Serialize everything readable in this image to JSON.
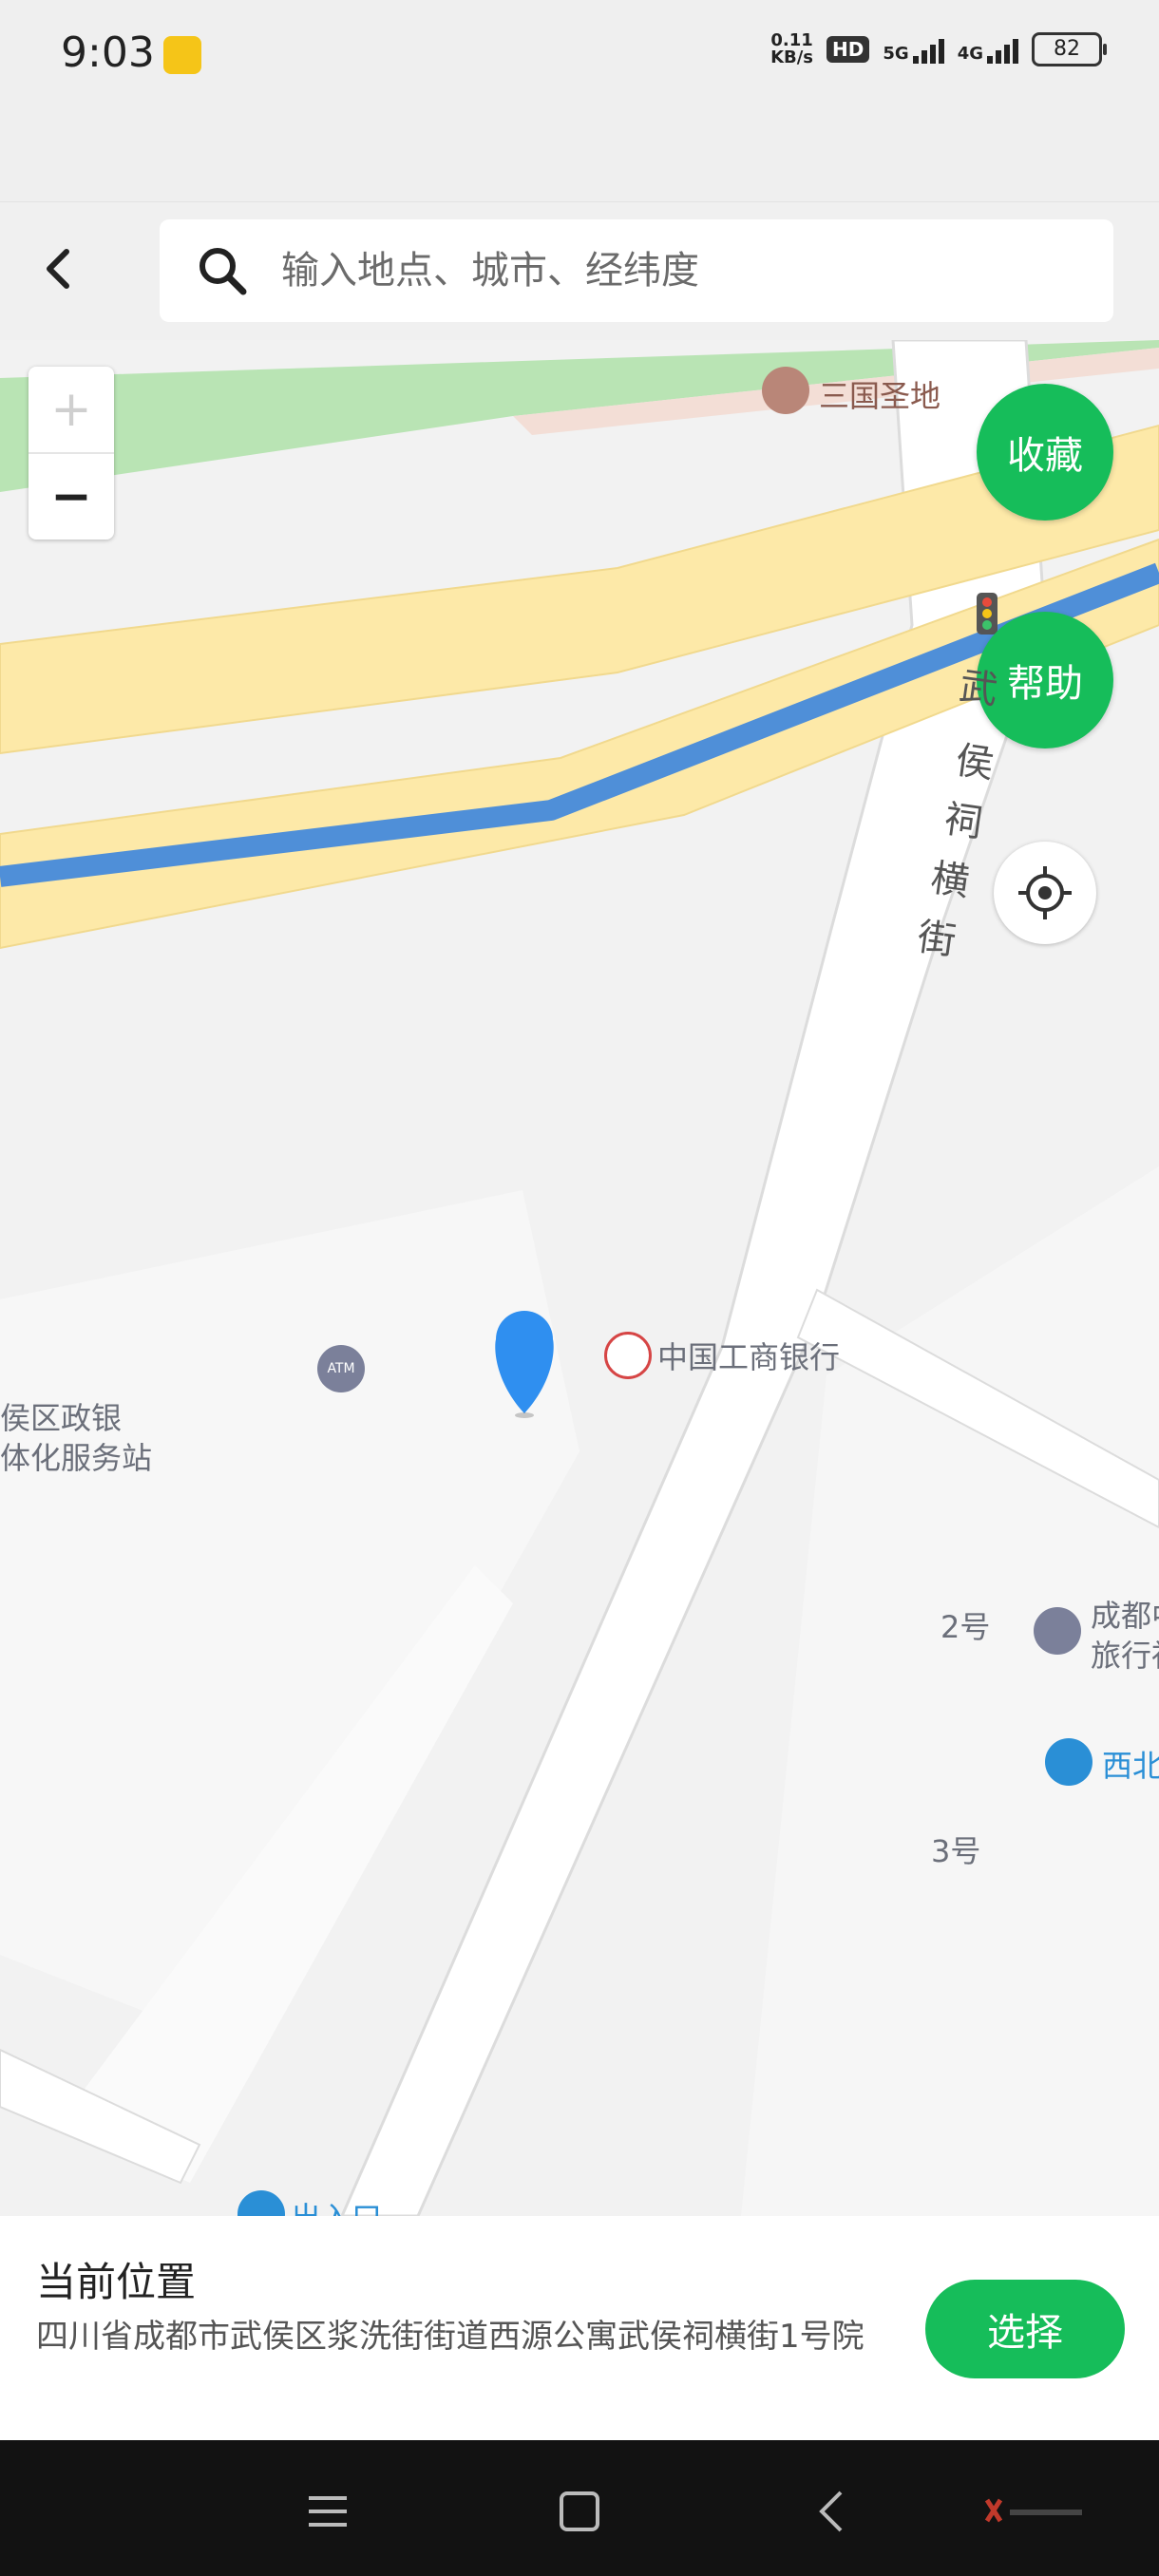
{
  "status_bar": {
    "time": "9:03",
    "net_speed_value": "0.11",
    "net_speed_unit": "KB/s",
    "hd": "HD",
    "sim1": "5G",
    "sim2": "4G",
    "battery": "82"
  },
  "header": {
    "search_placeholder": "输入地点、城市、经纬度"
  },
  "map": {
    "zoom_in": "+",
    "zoom_out": "−",
    "buttons": {
      "favorite": "收藏",
      "help": "帮助"
    },
    "street_name": [
      "武",
      "侯",
      "祠",
      "横",
      "街"
    ],
    "pois": {
      "sanguo": "三国圣地",
      "atm": "ATM",
      "icbc": "中国工商银行",
      "gov_line1": "武侯区政银",
      "gov_line2": "一体化服务站",
      "chengdu_line1": "成都中",
      "chengdu_line2": "旅行社",
      "gate2": "2号",
      "gate3": "3号",
      "xibei": "西北",
      "exit": "出入口"
    },
    "colors": {
      "road_yellow": "#fde9a8",
      "road_blue": "#4f8fd8",
      "green_area": "#b9e4b4",
      "accent_green": "#16bd5a",
      "marker_blue": "#2f8ff0"
    }
  },
  "bottom_panel": {
    "title": "当前位置",
    "address": "四川省成都市武侯区浆洗街街道西源公寓武侯祠横街1号院",
    "select_label": "选择"
  }
}
